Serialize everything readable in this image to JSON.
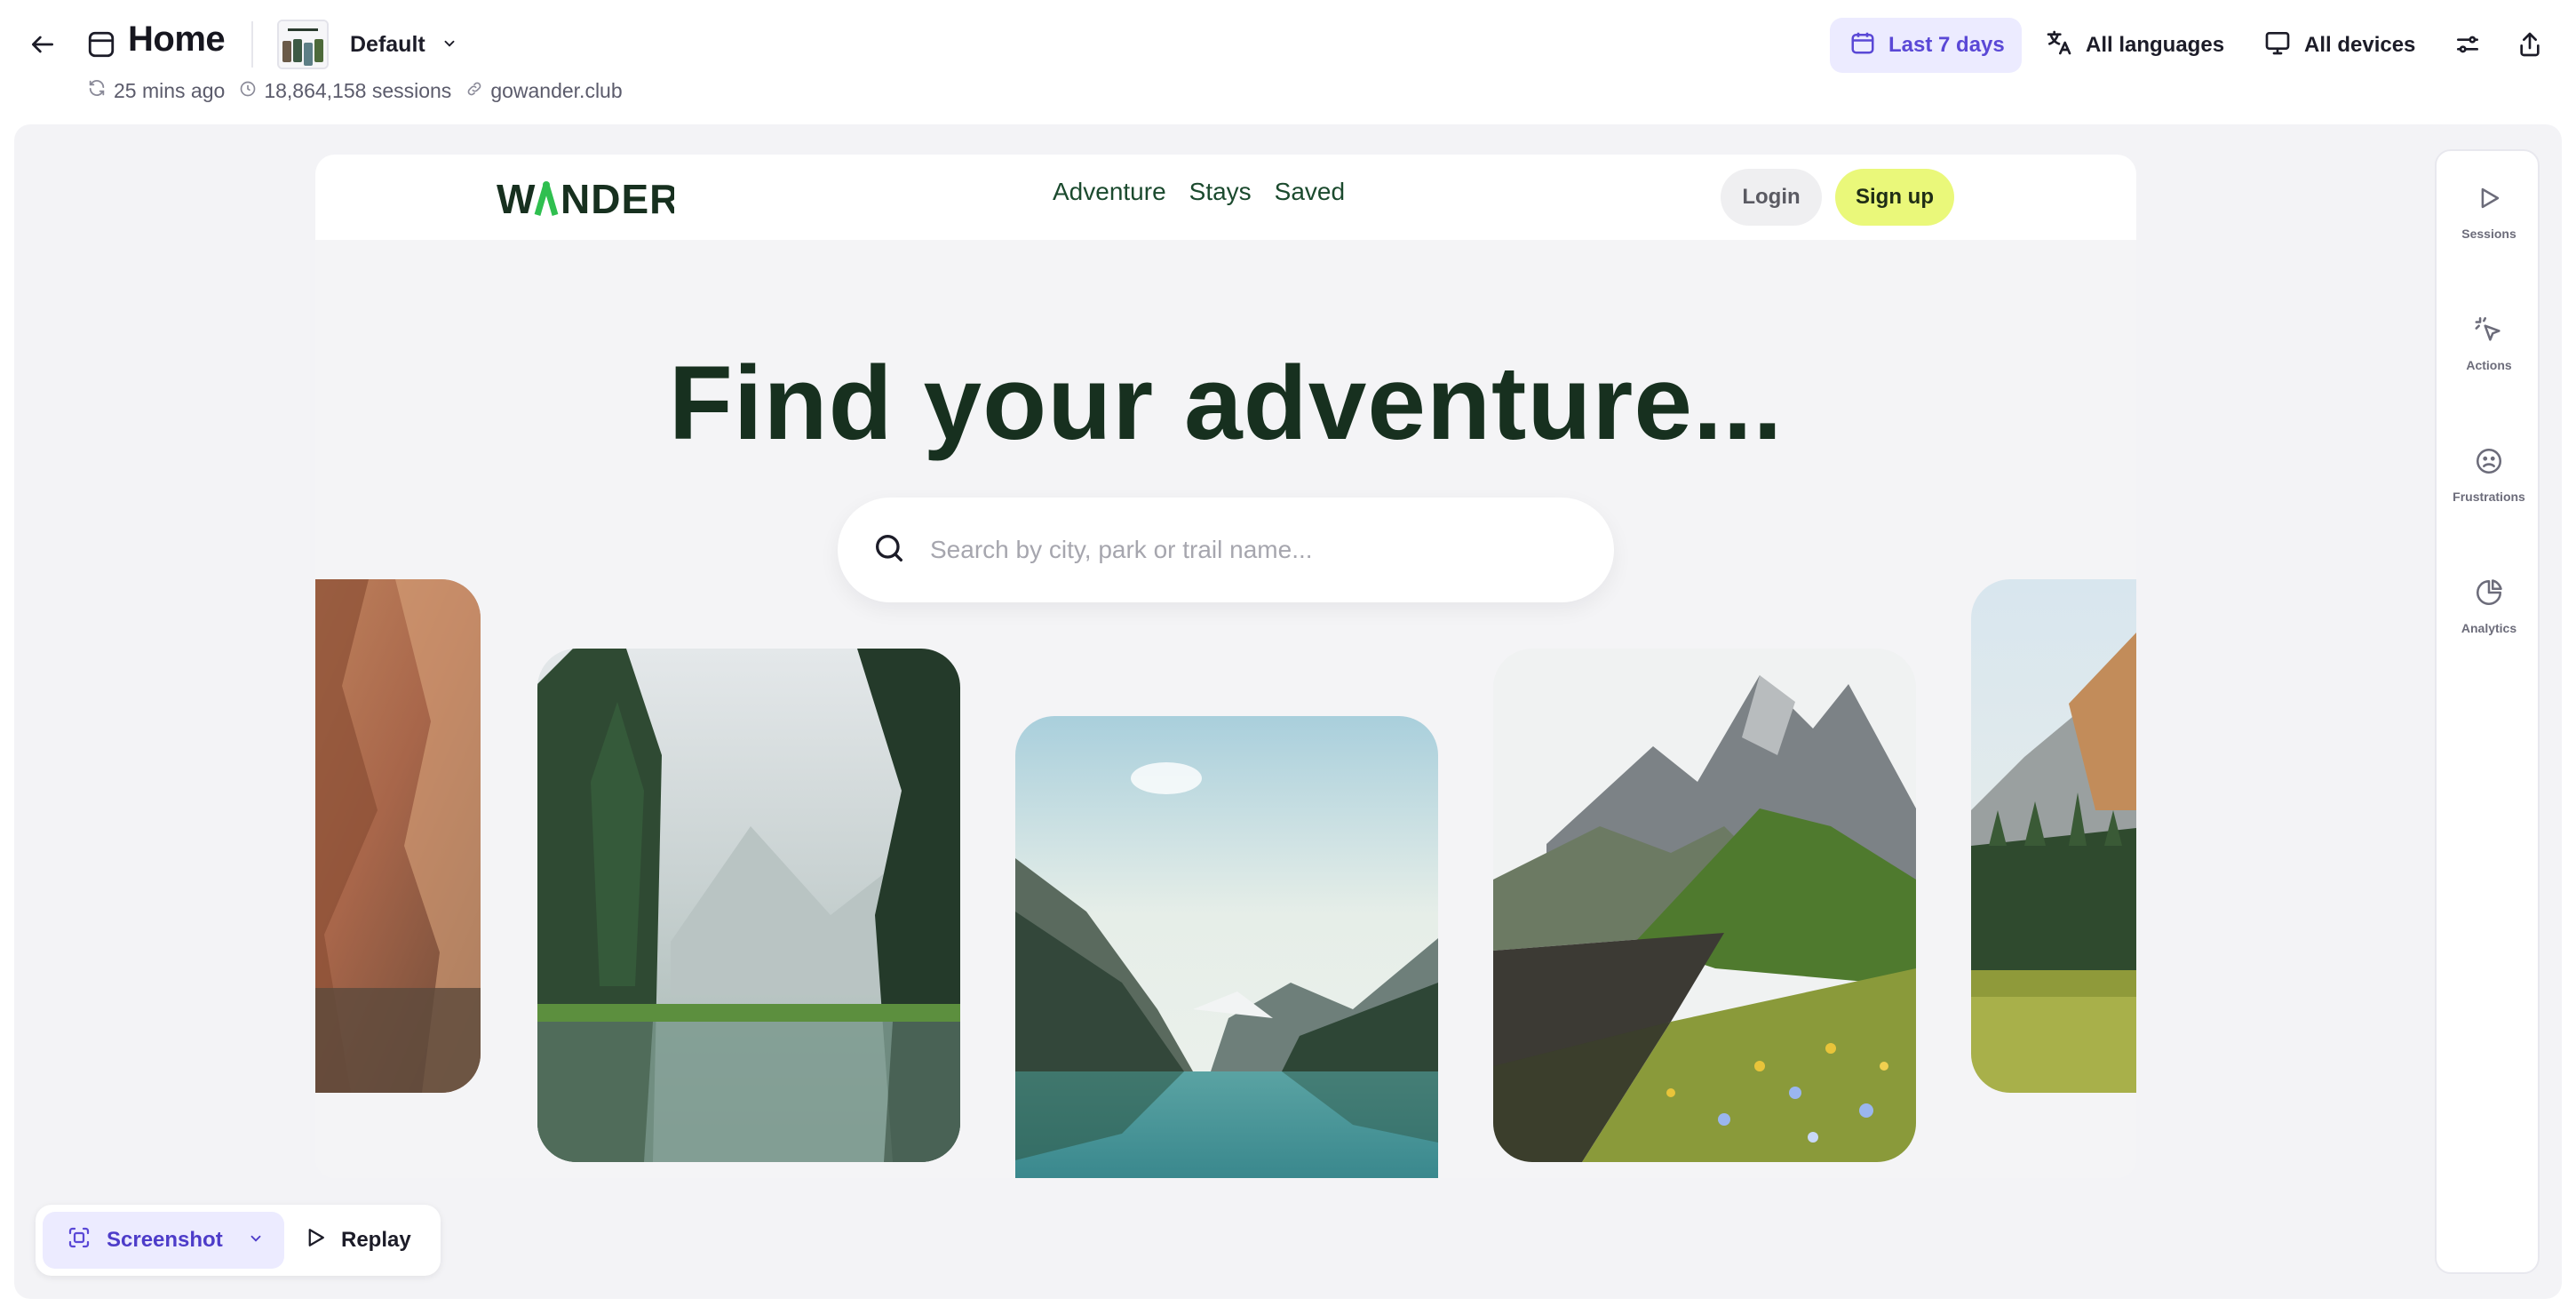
{
  "header": {
    "title": "Home",
    "variant": "Default",
    "meta": {
      "updated": "25 mins ago",
      "sessions": "18,864,158 sessions",
      "domain": "gowander.club"
    },
    "filters": {
      "date_range": "Last 7 days",
      "languages": "All languages",
      "devices": "All devices"
    }
  },
  "site": {
    "logo": "WANDER",
    "nav": [
      "Adventure",
      "Stays",
      "Saved"
    ],
    "login_label": "Login",
    "signup_label": "Sign up",
    "hero_title": "Find your adventure...",
    "search_placeholder": "Search by city, park or trail name..."
  },
  "rail": {
    "items": [
      {
        "label": "Sessions",
        "icon": "play-icon"
      },
      {
        "label": "Actions",
        "icon": "click-icon"
      },
      {
        "label": "Frustrations",
        "icon": "frown-icon"
      },
      {
        "label": "Analytics",
        "icon": "pie-chart-icon"
      }
    ]
  },
  "bottom": {
    "mode_label": "Screenshot",
    "replay_label": "Replay"
  },
  "colors": {
    "accent": "#5a48d6",
    "accent_bg": "#ecebff",
    "brand_green": "#17301f",
    "signup_yellow": "#eaf87a"
  }
}
